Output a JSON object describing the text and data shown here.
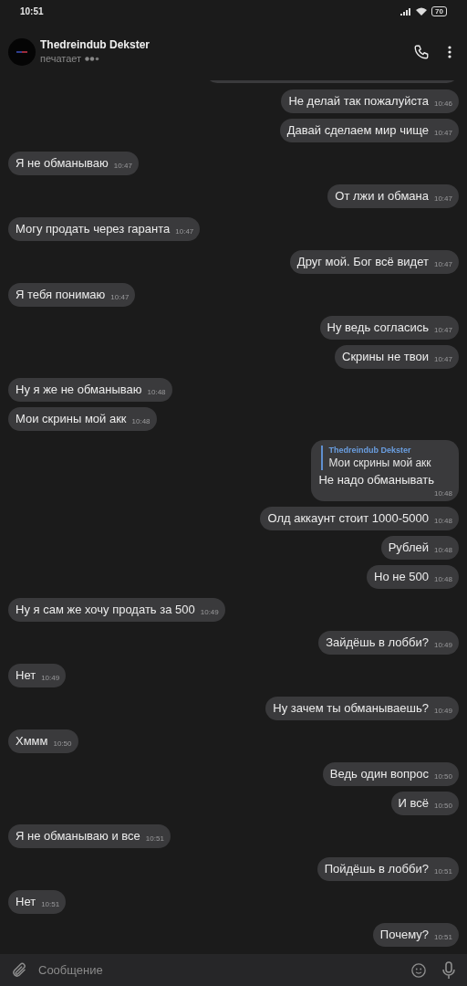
{
  "status_bar": {
    "time": "10:51",
    "battery": "70"
  },
  "chat": {
    "name": "Thedreindub Dekster",
    "status": "печатает"
  },
  "messages": [
    {
      "kind": "outgoing",
      "text": "Не делай так пожалуйста",
      "time": "10:46"
    },
    {
      "kind": "outgoing",
      "text": "Давай сделаем мир чище",
      "time": "10:47"
    },
    {
      "kind": "incoming",
      "text": "Я не обманываю",
      "time": "10:47"
    },
    {
      "kind": "outgoing",
      "text": "От лжи и обмана",
      "time": "10:47"
    },
    {
      "kind": "incoming",
      "text": "Могу продать через гаранта",
      "time": "10:47"
    },
    {
      "kind": "outgoing",
      "text": "Друг мой. Бог всё видет",
      "time": "10:47"
    },
    {
      "kind": "incoming",
      "text": "Я тебя понимаю",
      "time": "10:47"
    },
    {
      "kind": "outgoing",
      "text": "Ну ведь согласись",
      "time": "10:47"
    },
    {
      "kind": "outgoing",
      "text": "Скрины не твои",
      "time": "10:47"
    },
    {
      "kind": "incoming",
      "text": "Ну я же не обманываю",
      "time": "10:48"
    },
    {
      "kind": "incoming",
      "text": "Мои скрины мой акк",
      "time": "10:48"
    },
    {
      "kind": "outgoing",
      "reply": {
        "author": "Thedreindub Dekster",
        "text": "Мои скрины мой акк"
      },
      "text": "Не надо обманывать",
      "time": "10:48"
    },
    {
      "kind": "outgoing",
      "text": "Олд аккаунт стоит 1000-5000",
      "time": "10:48"
    },
    {
      "kind": "outgoing",
      "text": "Рублей",
      "time": "10:48"
    },
    {
      "kind": "outgoing",
      "text": "Но не 500",
      "time": "10:48"
    },
    {
      "kind": "incoming",
      "text": "Ну я сам же хочу продать за 500",
      "time": "10:49"
    },
    {
      "kind": "outgoing",
      "text": "Зайдёшь в лобби?",
      "time": "10:49"
    },
    {
      "kind": "incoming",
      "text": "Нет",
      "time": "10:49"
    },
    {
      "kind": "outgoing",
      "text": "Ну зачем ты обманываешь?",
      "time": "10:49"
    },
    {
      "kind": "incoming",
      "text": "Хммм",
      "time": "10:50"
    },
    {
      "kind": "outgoing",
      "text": "Ведь один вопрос",
      "time": "10:50"
    },
    {
      "kind": "outgoing",
      "text": "И всё",
      "time": "10:50"
    },
    {
      "kind": "incoming",
      "text": "Я не обманываю и все",
      "time": "10:51"
    },
    {
      "kind": "outgoing",
      "text": "Пойдёшь в лобби?",
      "time": "10:51"
    },
    {
      "kind": "incoming",
      "text": "Нет",
      "time": "10:51"
    },
    {
      "kind": "outgoing",
      "text": "Почему?",
      "time": "10:51"
    }
  ],
  "composer": {
    "placeholder": "Сообщение"
  }
}
